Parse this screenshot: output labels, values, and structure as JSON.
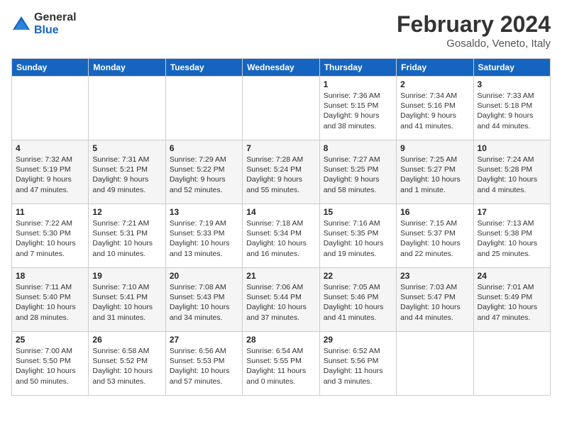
{
  "header": {
    "logo": {
      "general": "General",
      "blue": "Blue"
    },
    "title": "February 2024",
    "location": "Gosaldo, Veneto, Italy"
  },
  "calendar": {
    "days_of_week": [
      "Sunday",
      "Monday",
      "Tuesday",
      "Wednesday",
      "Thursday",
      "Friday",
      "Saturday"
    ],
    "weeks": [
      {
        "days": [
          {
            "num": "",
            "info": ""
          },
          {
            "num": "",
            "info": ""
          },
          {
            "num": "",
            "info": ""
          },
          {
            "num": "",
            "info": ""
          },
          {
            "num": "1",
            "info": "Sunrise: 7:36 AM\nSunset: 5:15 PM\nDaylight: 9 hours\nand 38 minutes."
          },
          {
            "num": "2",
            "info": "Sunrise: 7:34 AM\nSunset: 5:16 PM\nDaylight: 9 hours\nand 41 minutes."
          },
          {
            "num": "3",
            "info": "Sunrise: 7:33 AM\nSunset: 5:18 PM\nDaylight: 9 hours\nand 44 minutes."
          }
        ]
      },
      {
        "days": [
          {
            "num": "4",
            "info": "Sunrise: 7:32 AM\nSunset: 5:19 PM\nDaylight: 9 hours\nand 47 minutes."
          },
          {
            "num": "5",
            "info": "Sunrise: 7:31 AM\nSunset: 5:21 PM\nDaylight: 9 hours\nand 49 minutes."
          },
          {
            "num": "6",
            "info": "Sunrise: 7:29 AM\nSunset: 5:22 PM\nDaylight: 9 hours\nand 52 minutes."
          },
          {
            "num": "7",
            "info": "Sunrise: 7:28 AM\nSunset: 5:24 PM\nDaylight: 9 hours\nand 55 minutes."
          },
          {
            "num": "8",
            "info": "Sunrise: 7:27 AM\nSunset: 5:25 PM\nDaylight: 9 hours\nand 58 minutes."
          },
          {
            "num": "9",
            "info": "Sunrise: 7:25 AM\nSunset: 5:27 PM\nDaylight: 10 hours\nand 1 minute."
          },
          {
            "num": "10",
            "info": "Sunrise: 7:24 AM\nSunset: 5:28 PM\nDaylight: 10 hours\nand 4 minutes."
          }
        ]
      },
      {
        "days": [
          {
            "num": "11",
            "info": "Sunrise: 7:22 AM\nSunset: 5:30 PM\nDaylight: 10 hours\nand 7 minutes."
          },
          {
            "num": "12",
            "info": "Sunrise: 7:21 AM\nSunset: 5:31 PM\nDaylight: 10 hours\nand 10 minutes."
          },
          {
            "num": "13",
            "info": "Sunrise: 7:19 AM\nSunset: 5:33 PM\nDaylight: 10 hours\nand 13 minutes."
          },
          {
            "num": "14",
            "info": "Sunrise: 7:18 AM\nSunset: 5:34 PM\nDaylight: 10 hours\nand 16 minutes."
          },
          {
            "num": "15",
            "info": "Sunrise: 7:16 AM\nSunset: 5:35 PM\nDaylight: 10 hours\nand 19 minutes."
          },
          {
            "num": "16",
            "info": "Sunrise: 7:15 AM\nSunset: 5:37 PM\nDaylight: 10 hours\nand 22 minutes."
          },
          {
            "num": "17",
            "info": "Sunrise: 7:13 AM\nSunset: 5:38 PM\nDaylight: 10 hours\nand 25 minutes."
          }
        ]
      },
      {
        "days": [
          {
            "num": "18",
            "info": "Sunrise: 7:11 AM\nSunset: 5:40 PM\nDaylight: 10 hours\nand 28 minutes."
          },
          {
            "num": "19",
            "info": "Sunrise: 7:10 AM\nSunset: 5:41 PM\nDaylight: 10 hours\nand 31 minutes."
          },
          {
            "num": "20",
            "info": "Sunrise: 7:08 AM\nSunset: 5:43 PM\nDaylight: 10 hours\nand 34 minutes."
          },
          {
            "num": "21",
            "info": "Sunrise: 7:06 AM\nSunset: 5:44 PM\nDaylight: 10 hours\nand 37 minutes."
          },
          {
            "num": "22",
            "info": "Sunrise: 7:05 AM\nSunset: 5:46 PM\nDaylight: 10 hours\nand 41 minutes."
          },
          {
            "num": "23",
            "info": "Sunrise: 7:03 AM\nSunset: 5:47 PM\nDaylight: 10 hours\nand 44 minutes."
          },
          {
            "num": "24",
            "info": "Sunrise: 7:01 AM\nSunset: 5:49 PM\nDaylight: 10 hours\nand 47 minutes."
          }
        ]
      },
      {
        "days": [
          {
            "num": "25",
            "info": "Sunrise: 7:00 AM\nSunset: 5:50 PM\nDaylight: 10 hours\nand 50 minutes."
          },
          {
            "num": "26",
            "info": "Sunrise: 6:58 AM\nSunset: 5:52 PM\nDaylight: 10 hours\nand 53 minutes."
          },
          {
            "num": "27",
            "info": "Sunrise: 6:56 AM\nSunset: 5:53 PM\nDaylight: 10 hours\nand 57 minutes."
          },
          {
            "num": "28",
            "info": "Sunrise: 6:54 AM\nSunset: 5:55 PM\nDaylight: 11 hours\nand 0 minutes."
          },
          {
            "num": "29",
            "info": "Sunrise: 6:52 AM\nSunset: 5:56 PM\nDaylight: 11 hours\nand 3 minutes."
          },
          {
            "num": "",
            "info": ""
          },
          {
            "num": "",
            "info": ""
          }
        ]
      }
    ]
  }
}
